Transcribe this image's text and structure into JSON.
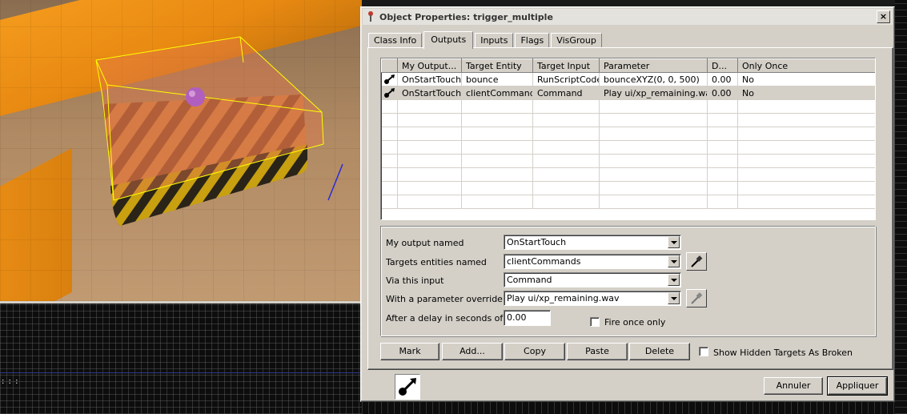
{
  "dialog": {
    "title": "Object Properties: trigger_multiple",
    "close_label": "×",
    "tabs": [
      {
        "label": "Class Info",
        "active": false
      },
      {
        "label": "Outputs",
        "active": true
      },
      {
        "label": "Inputs",
        "active": false
      },
      {
        "label": "Flags",
        "active": false
      },
      {
        "label": "VisGroup",
        "active": false
      }
    ]
  },
  "outputs_table": {
    "columns": [
      "My Output...",
      "Target Entity",
      "Target Input",
      "Parameter",
      "D...",
      "Only Once"
    ],
    "rows": [
      {
        "icon": "output-arrow-icon",
        "output": "OnStartTouch",
        "target": "bounce",
        "input": "RunScriptCode",
        "parameter": "bounceXYZ(0, 0, 500)",
        "delay": "0.00",
        "once": "No",
        "selected": false
      },
      {
        "icon": "output-arrow-icon",
        "output": "OnStartTouch",
        "target": "clientCommands",
        "input": "Command",
        "parameter": "Play ui/xp_remaining.wav",
        "delay": "0.00",
        "once": "No",
        "selected": true
      }
    ]
  },
  "form": {
    "output_label": "My output named",
    "output_value": "OnStartTouch",
    "targets_label": "Targets entities named",
    "targets_value": "clientCommands",
    "input_label": "Via this input",
    "input_value": "Command",
    "parameter_label": "With a parameter override",
    "parameter_value": "Play ui/xp_remaining.wav",
    "delay_label": "After a delay in seconds of",
    "delay_value": "0.00",
    "fire_once_label": "Fire once only",
    "fire_once_checked": false
  },
  "buttons": {
    "mark": "Mark",
    "add": "Add...",
    "copy": "Copy",
    "paste": "Paste",
    "delete": "Delete",
    "show_hidden_label": "Show Hidden Targets As Broken",
    "cancel": "Annuler",
    "apply": "Appliquer"
  },
  "colors": {
    "dialog_bg": "#d4d0c8",
    "selection_bg": "#d4d0c8",
    "brush_outline": "#ffff00",
    "trigger_fill": "#e0764a"
  },
  "icons": {
    "title": "entity-pin-icon",
    "eyedropper": "eyedropper-icon",
    "entity_big": "output-entity-icon"
  }
}
